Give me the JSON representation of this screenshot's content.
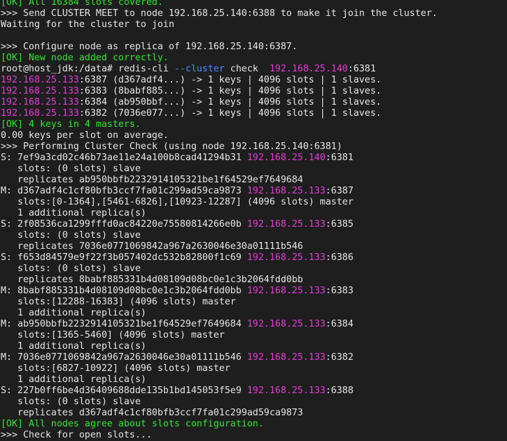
{
  "colors": {
    "background": "#1e1e1e",
    "default_text": "#e6e6e6",
    "ok_green": "#2ee62e",
    "ip_magenta": "#e53ad7",
    "flag_blue": "#4d8cff"
  },
  "terminal": {
    "lines": [
      [
        {
          "t": "[OK] All 16384 slots covered.",
          "c": "green"
        }
      ],
      [
        {
          "t": ">>> Send CLUSTER MEET to node 192.168.25.140:6388 to make it join the cluster.",
          "c": "default"
        }
      ],
      [
        {
          "t": "Waiting for the cluster to join",
          "c": "default"
        }
      ],
      [
        {
          "t": "",
          "c": "default"
        }
      ],
      [
        {
          "t": ">>> Configure node as replica of 192.168.25.140:6387.",
          "c": "default"
        }
      ],
      [
        {
          "t": "[OK] New node added correctly.",
          "c": "green"
        }
      ],
      [
        {
          "t": "root@host_jdk:/data# redis-cli ",
          "c": "default"
        },
        {
          "t": "--cluster",
          "c": "blue"
        },
        {
          "t": " check  ",
          "c": "default"
        },
        {
          "t": "192.168.25.140",
          "c": "magenta"
        },
        {
          "t": ":6381",
          "c": "default"
        }
      ],
      [
        {
          "t": "192.168.25.133",
          "c": "magenta"
        },
        {
          "t": ":6387 (d367adf4...) -> 1 keys | 4096 slots | 1 slaves.",
          "c": "default"
        }
      ],
      [
        {
          "t": "192.168.25.133",
          "c": "magenta"
        },
        {
          "t": ":6383 (8babf885...) -> 1 keys | 4096 slots | 1 slaves.",
          "c": "default"
        }
      ],
      [
        {
          "t": "192.168.25.133",
          "c": "magenta"
        },
        {
          "t": ":6384 (ab950bbf...) -> 1 keys | 4096 slots | 1 slaves.",
          "c": "default"
        }
      ],
      [
        {
          "t": "192.168.25.133",
          "c": "magenta"
        },
        {
          "t": ":6382 (7036e077...) -> 1 keys | 4096 slots | 1 slaves.",
          "c": "default"
        }
      ],
      [
        {
          "t": "[OK] 4 keys in 4 masters.",
          "c": "green"
        }
      ],
      [
        {
          "t": "0.00 keys per slot on average.",
          "c": "default"
        }
      ],
      [
        {
          "t": ">>> Performing Cluster Check (using node 192.168.25.140:6381)",
          "c": "default"
        }
      ],
      [
        {
          "t": "S: 7ef9a3cd02c46b73ae11e24a100b8cad41294b31 ",
          "c": "default"
        },
        {
          "t": "192.168.25.140",
          "c": "magenta"
        },
        {
          "t": ":6381",
          "c": "default"
        }
      ],
      [
        {
          "t": "   slots: (0 slots) slave",
          "c": "default"
        }
      ],
      [
        {
          "t": "   replicates ab950bbfb2232914105321be1f64529ef7649684",
          "c": "default"
        }
      ],
      [
        {
          "t": "M: d367adf4c1cf80bfb3ccf7fa01c299ad59ca9873 ",
          "c": "default"
        },
        {
          "t": "192.168.25.133",
          "c": "magenta"
        },
        {
          "t": ":6387",
          "c": "default"
        }
      ],
      [
        {
          "t": "   slots:[0-1364],[5461-6826],[10923-12287] (4096 slots) master",
          "c": "default"
        }
      ],
      [
        {
          "t": "   1 additional replica(s)",
          "c": "default"
        }
      ],
      [
        {
          "t": "S: 2f08536ca1299fffd0ac84220e75580814266e0b ",
          "c": "default"
        },
        {
          "t": "192.168.25.133",
          "c": "magenta"
        },
        {
          "t": ":6385",
          "c": "default"
        }
      ],
      [
        {
          "t": "   slots: (0 slots) slave",
          "c": "default"
        }
      ],
      [
        {
          "t": "   replicates 7036e0771069842a967a2630046e30a01111b546",
          "c": "default"
        }
      ],
      [
        {
          "t": "S: f653d84579e9f22f3b057402dc532b82800f1c69 ",
          "c": "default"
        },
        {
          "t": "192.168.25.133",
          "c": "magenta"
        },
        {
          "t": ":6386",
          "c": "default"
        }
      ],
      [
        {
          "t": "   slots: (0 slots) slave",
          "c": "default"
        }
      ],
      [
        {
          "t": "   replicates 8babf885331b4d08109d08bc0e1c3b2064fdd0bb",
          "c": "default"
        }
      ],
      [
        {
          "t": "M: 8babf885331b4d08109d08bc0e1c3b2064fdd0bb ",
          "c": "default"
        },
        {
          "t": "192.168.25.133",
          "c": "magenta"
        },
        {
          "t": ":6383",
          "c": "default"
        }
      ],
      [
        {
          "t": "   slots:[12288-16383] (4096 slots) master",
          "c": "default"
        }
      ],
      [
        {
          "t": "   1 additional replica(s)",
          "c": "default"
        }
      ],
      [
        {
          "t": "M: ab950bbfb2232914105321be1f64529ef7649684 ",
          "c": "default"
        },
        {
          "t": "192.168.25.133",
          "c": "magenta"
        },
        {
          "t": ":6384",
          "c": "default"
        }
      ],
      [
        {
          "t": "   slots:[1365-5460] (4096 slots) master",
          "c": "default"
        }
      ],
      [
        {
          "t": "   1 additional replica(s)",
          "c": "default"
        }
      ],
      [
        {
          "t": "M: 7036e0771069842a967a2630046e30a01111b546 ",
          "c": "default"
        },
        {
          "t": "192.168.25.133",
          "c": "magenta"
        },
        {
          "t": ":6382",
          "c": "default"
        }
      ],
      [
        {
          "t": "   slots:[6827-10922] (4096 slots) master",
          "c": "default"
        }
      ],
      [
        {
          "t": "   1 additional replica(s)",
          "c": "default"
        }
      ],
      [
        {
          "t": "S: 227b0ff6be4d36409688dde135b1bd145053f5e9 ",
          "c": "default"
        },
        {
          "t": "192.168.25.133",
          "c": "magenta"
        },
        {
          "t": ":6388",
          "c": "default"
        }
      ],
      [
        {
          "t": "   slots: (0 slots) slave",
          "c": "default"
        }
      ],
      [
        {
          "t": "   replicates d367adf4c1cf80bfb3ccf7fa01c299ad59ca9873",
          "c": "default"
        }
      ],
      [
        {
          "t": "[OK] All nodes agree about slots configuration.",
          "c": "green"
        }
      ],
      [
        {
          "t": ">>> Check for open slots...",
          "c": "default"
        }
      ]
    ]
  }
}
